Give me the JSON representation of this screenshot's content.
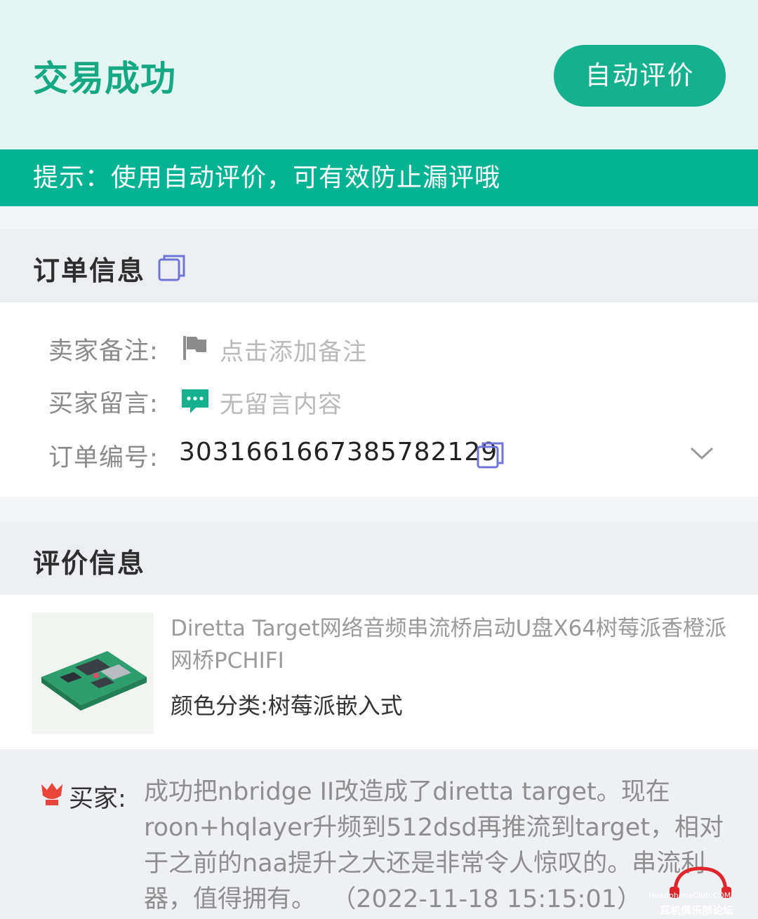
{
  "header": {
    "title": "交易成功",
    "auto_review_button": "自动评价"
  },
  "tip": "提示：使用自动评价，可有效防止漏评哦",
  "order_info": {
    "section_title": "订单信息",
    "seller_note_label": "卖家备注:",
    "seller_note_placeholder": "点击添加备注",
    "buyer_message_label": "买家留言:",
    "buyer_message_value": "无留言内容",
    "order_number_label": "订单编号:",
    "order_number": "3031661667385782129"
  },
  "review_info": {
    "section_title": "评价信息",
    "product_title": "Diretta Target网络音频串流桥启动U盘X64树莓派香橙派网桥PCHIFI",
    "product_spec": "颜色分类:树莓派嵌入式",
    "reviewer_label": "买家:",
    "review_text": "成功把nbridge II改造成了diretta target。现在roon+hqlayer升频到512dsd再推流到target，相对于之前的naa提升之大还是非常令人惊叹的。串流利器，值得拥有。",
    "review_time": "（2022-11-18 15:15:01）"
  },
  "watermark": {
    "line1": "HeadphoneClub.COM",
    "line2": "耳机俱乐部论坛"
  },
  "colors": {
    "accent": "#04b393",
    "header_bg": "#e3f6f1",
    "copy_icon": "#6f74d6",
    "chat_icon": "#16b08f"
  }
}
